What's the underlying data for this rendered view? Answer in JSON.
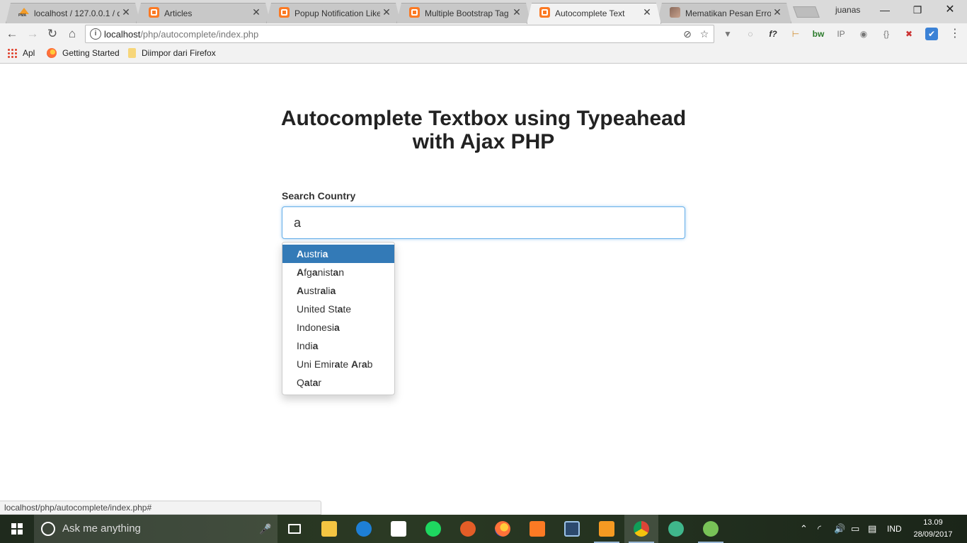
{
  "browser": {
    "tabs": [
      {
        "title": "localhost / 127.0.0.1 / d",
        "favicon": "phpmyadmin-icon"
      },
      {
        "title": "Articles",
        "favicon": "xampp-icon"
      },
      {
        "title": "Popup Notification Like",
        "favicon": "xampp-icon"
      },
      {
        "title": "Multiple Bootstrap Tag",
        "favicon": "xampp-icon"
      },
      {
        "title": "Autocomplete Text",
        "favicon": "xampp-icon",
        "active": true
      },
      {
        "title": "Mematikan Pesan Error",
        "favicon": "image-icon"
      }
    ],
    "profile_name": "juanas",
    "url_host": "localhost",
    "url_path": "/php/autocomplete/index.php",
    "bookmarks": [
      {
        "label": "Apl",
        "icon": "apps-grid-icon"
      },
      {
        "label": "Getting Started",
        "icon": "firefox-icon"
      },
      {
        "label": "Diimpor dari Firefox",
        "icon": "folder-icon"
      }
    ],
    "status_url": "localhost/php/autocomplete/index.php#"
  },
  "page": {
    "title": "Autocomplete Textbox using Typeahead with Ajax PHP",
    "field_label": "Search Country",
    "search_value": "a",
    "suggestions": [
      {
        "parts": [
          "A",
          "ustri",
          "a"
        ],
        "active": true
      },
      {
        "parts": [
          "A",
          "fg",
          "a",
          "nist",
          "a",
          "n"
        ]
      },
      {
        "parts": [
          "A",
          "ustr",
          "a",
          "li",
          "a"
        ]
      },
      {
        "parts": [
          "United St",
          "a",
          "te"
        ]
      },
      {
        "parts": [
          "Indonesi",
          "a"
        ]
      },
      {
        "parts": [
          "Indi",
          "a"
        ]
      },
      {
        "parts": [
          "Uni Emir",
          "a",
          "te ",
          "A",
          "r",
          "a",
          "b"
        ]
      },
      {
        "parts": [
          "Q",
          "a",
          "t",
          "a",
          "r"
        ]
      }
    ]
  },
  "taskbar": {
    "search_placeholder": "Ask me anything",
    "language": "IND",
    "time": "13.09",
    "date": "28/09/2017"
  },
  "colors": {
    "highlight": "#337ab7",
    "focus_border": "#66afe9"
  }
}
